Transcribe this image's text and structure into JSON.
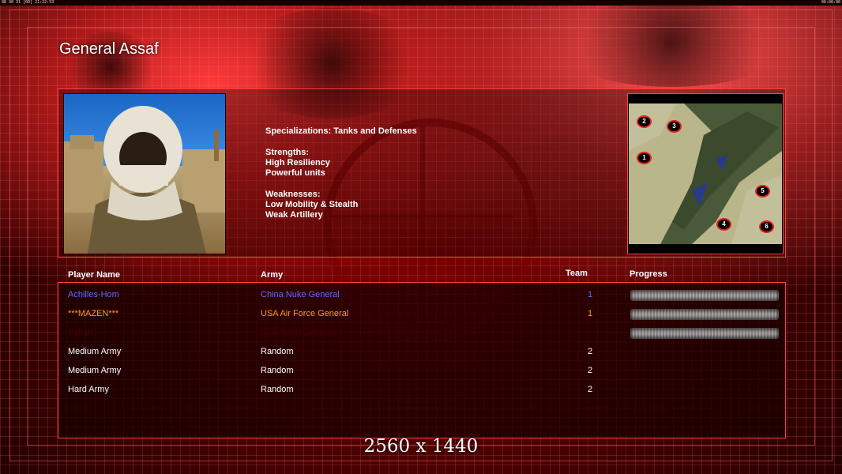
{
  "topbar": {
    "left_text": "08 30 31 [00] 21:22:53",
    "right_text": "00:00:00"
  },
  "general": {
    "name": "General Assaf"
  },
  "info": {
    "specializations": "Specializations: Tanks and Defenses",
    "strengths_title": "Strengths:",
    "strengths": [
      "High Resiliency",
      "Powerful units"
    ],
    "weaknesses_title": "Weaknesses:",
    "weaknesses": [
      "Low Mobility & Stealth",
      "Weak Artillery"
    ]
  },
  "minimap": {
    "markers": [
      "2",
      "3",
      "1",
      "5",
      "4",
      "6"
    ]
  },
  "table": {
    "headers": {
      "name": "Player Name",
      "army": "Army",
      "team": "Team",
      "progress": "Progress"
    },
    "rows": [
      {
        "name": "Achilles-Hom",
        "army": "China Nuke General",
        "team": "1",
        "color": "#5a6bff",
        "progress": 1.0
      },
      {
        "name": "***MAZEN***",
        "army": "USA Air Force General",
        "team": "1",
        "color": "#ff9a1a",
        "progress": 1.0
      },
      {
        "name": "Sultan",
        "army": "GLA Toxin General",
        "team": "",
        "color": "#4a0000",
        "progress": 1.0
      },
      {
        "name": "Medium Army",
        "army": "Random",
        "team": "2",
        "color": "#ffffff"
      },
      {
        "name": "Medium Army",
        "army": "Random",
        "team": "2",
        "color": "#ffffff"
      },
      {
        "name": "Hard Army",
        "army": "Random",
        "team": "2",
        "color": "#ffffff"
      }
    ]
  },
  "resolution_label": "2560 x 1440",
  "colors": {
    "accent": "#ff4040",
    "background": "#3a0000"
  }
}
